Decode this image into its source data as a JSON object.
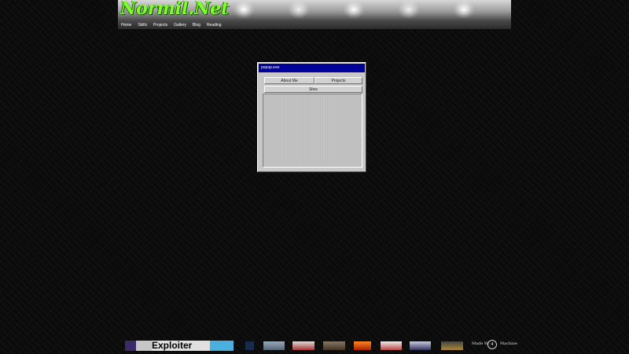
{
  "site": {
    "logo_text": "Normil.Net"
  },
  "nav": {
    "items": [
      {
        "label": "Home"
      },
      {
        "label": "Skills"
      },
      {
        "label": "Projects"
      },
      {
        "label": "Gallery"
      },
      {
        "label": "Blog"
      },
      {
        "label": "Reading"
      }
    ]
  },
  "popup": {
    "title": "popup.exe",
    "tabs": {
      "about": "About Me",
      "projects": "Projects",
      "sites": "Sites"
    }
  },
  "footer": {
    "exploiter_label": "Exploiter",
    "made_with": "Made With",
    "made_with_icon": "4",
    "machine": "Machine"
  }
}
